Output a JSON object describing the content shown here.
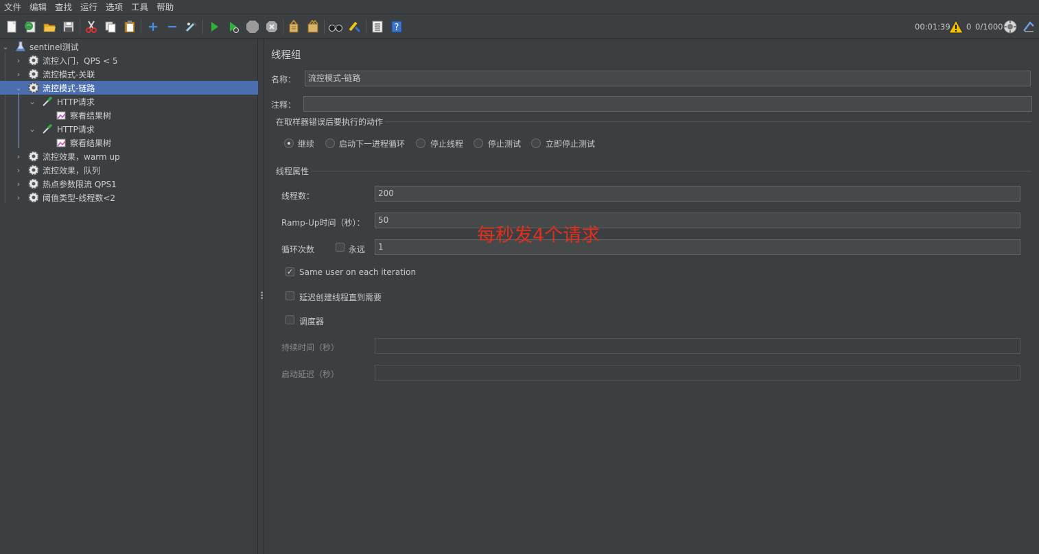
{
  "menu": [
    "文件",
    "编辑",
    "查找",
    "运行",
    "选项",
    "工具",
    "帮助"
  ],
  "toolbar": {
    "buttons": [
      "new-icon",
      "templates-icon",
      "open-icon",
      "save-icon",
      "cut-icon",
      "copy-icon",
      "paste-icon",
      "expand-icon",
      "collapse-icon",
      "toggle-icon",
      "start-icon",
      "start-no-pause-icon",
      "stop-icon",
      "shutdown-icon",
      "clear-icon",
      "clear-all-icon",
      "search-icon",
      "reset-search-icon",
      "function-helper-icon",
      "help-icon"
    ],
    "timer": "00:01:39",
    "warnings": "0",
    "threads": "0/1000"
  },
  "tree": {
    "root": "sentinel测试",
    "items": [
      {
        "label": "流控入门，QPS < 5"
      },
      {
        "label": "流控模式-关联"
      },
      {
        "label": "流控模式-链路"
      },
      {
        "label": "HTTP请求"
      },
      {
        "label": "察看结果树"
      },
      {
        "label": "HTTP请求"
      },
      {
        "label": "察看结果树"
      },
      {
        "label": "流控效果，warm up"
      },
      {
        "label": "流控效果，队列"
      },
      {
        "label": "热点参数限流 QPS1"
      },
      {
        "label": "阈值类型-线程数<2"
      }
    ]
  },
  "panel": {
    "title": "线程组",
    "name_label": "名称：",
    "name_value": "流控模式-链路",
    "comment_label": "注释：",
    "comment_value": "",
    "error_section": "在取样器错误后要执行的动作",
    "error_options": [
      "继续",
      "启动下一进程循环",
      "停止线程",
      "停止测试",
      "立即停止测试"
    ],
    "props_section": "线程属性",
    "threads_label": "线程数：",
    "threads_value": "200",
    "rampup_label": "Ramp-Up时间（秒）：",
    "rampup_value": "50",
    "loop_label": "循环次数",
    "forever_label": "永远",
    "loop_value": "1",
    "same_user_label": "Same user on each iteration",
    "delay_label": "延迟创建线程直到需要",
    "scheduler_label": "调度器",
    "duration_label": "持续时间（秒）",
    "duration_value": "",
    "startup_delay_label": "启动延迟（秒）",
    "startup_delay_value": "",
    "annotation": "每秒发4个请求"
  }
}
